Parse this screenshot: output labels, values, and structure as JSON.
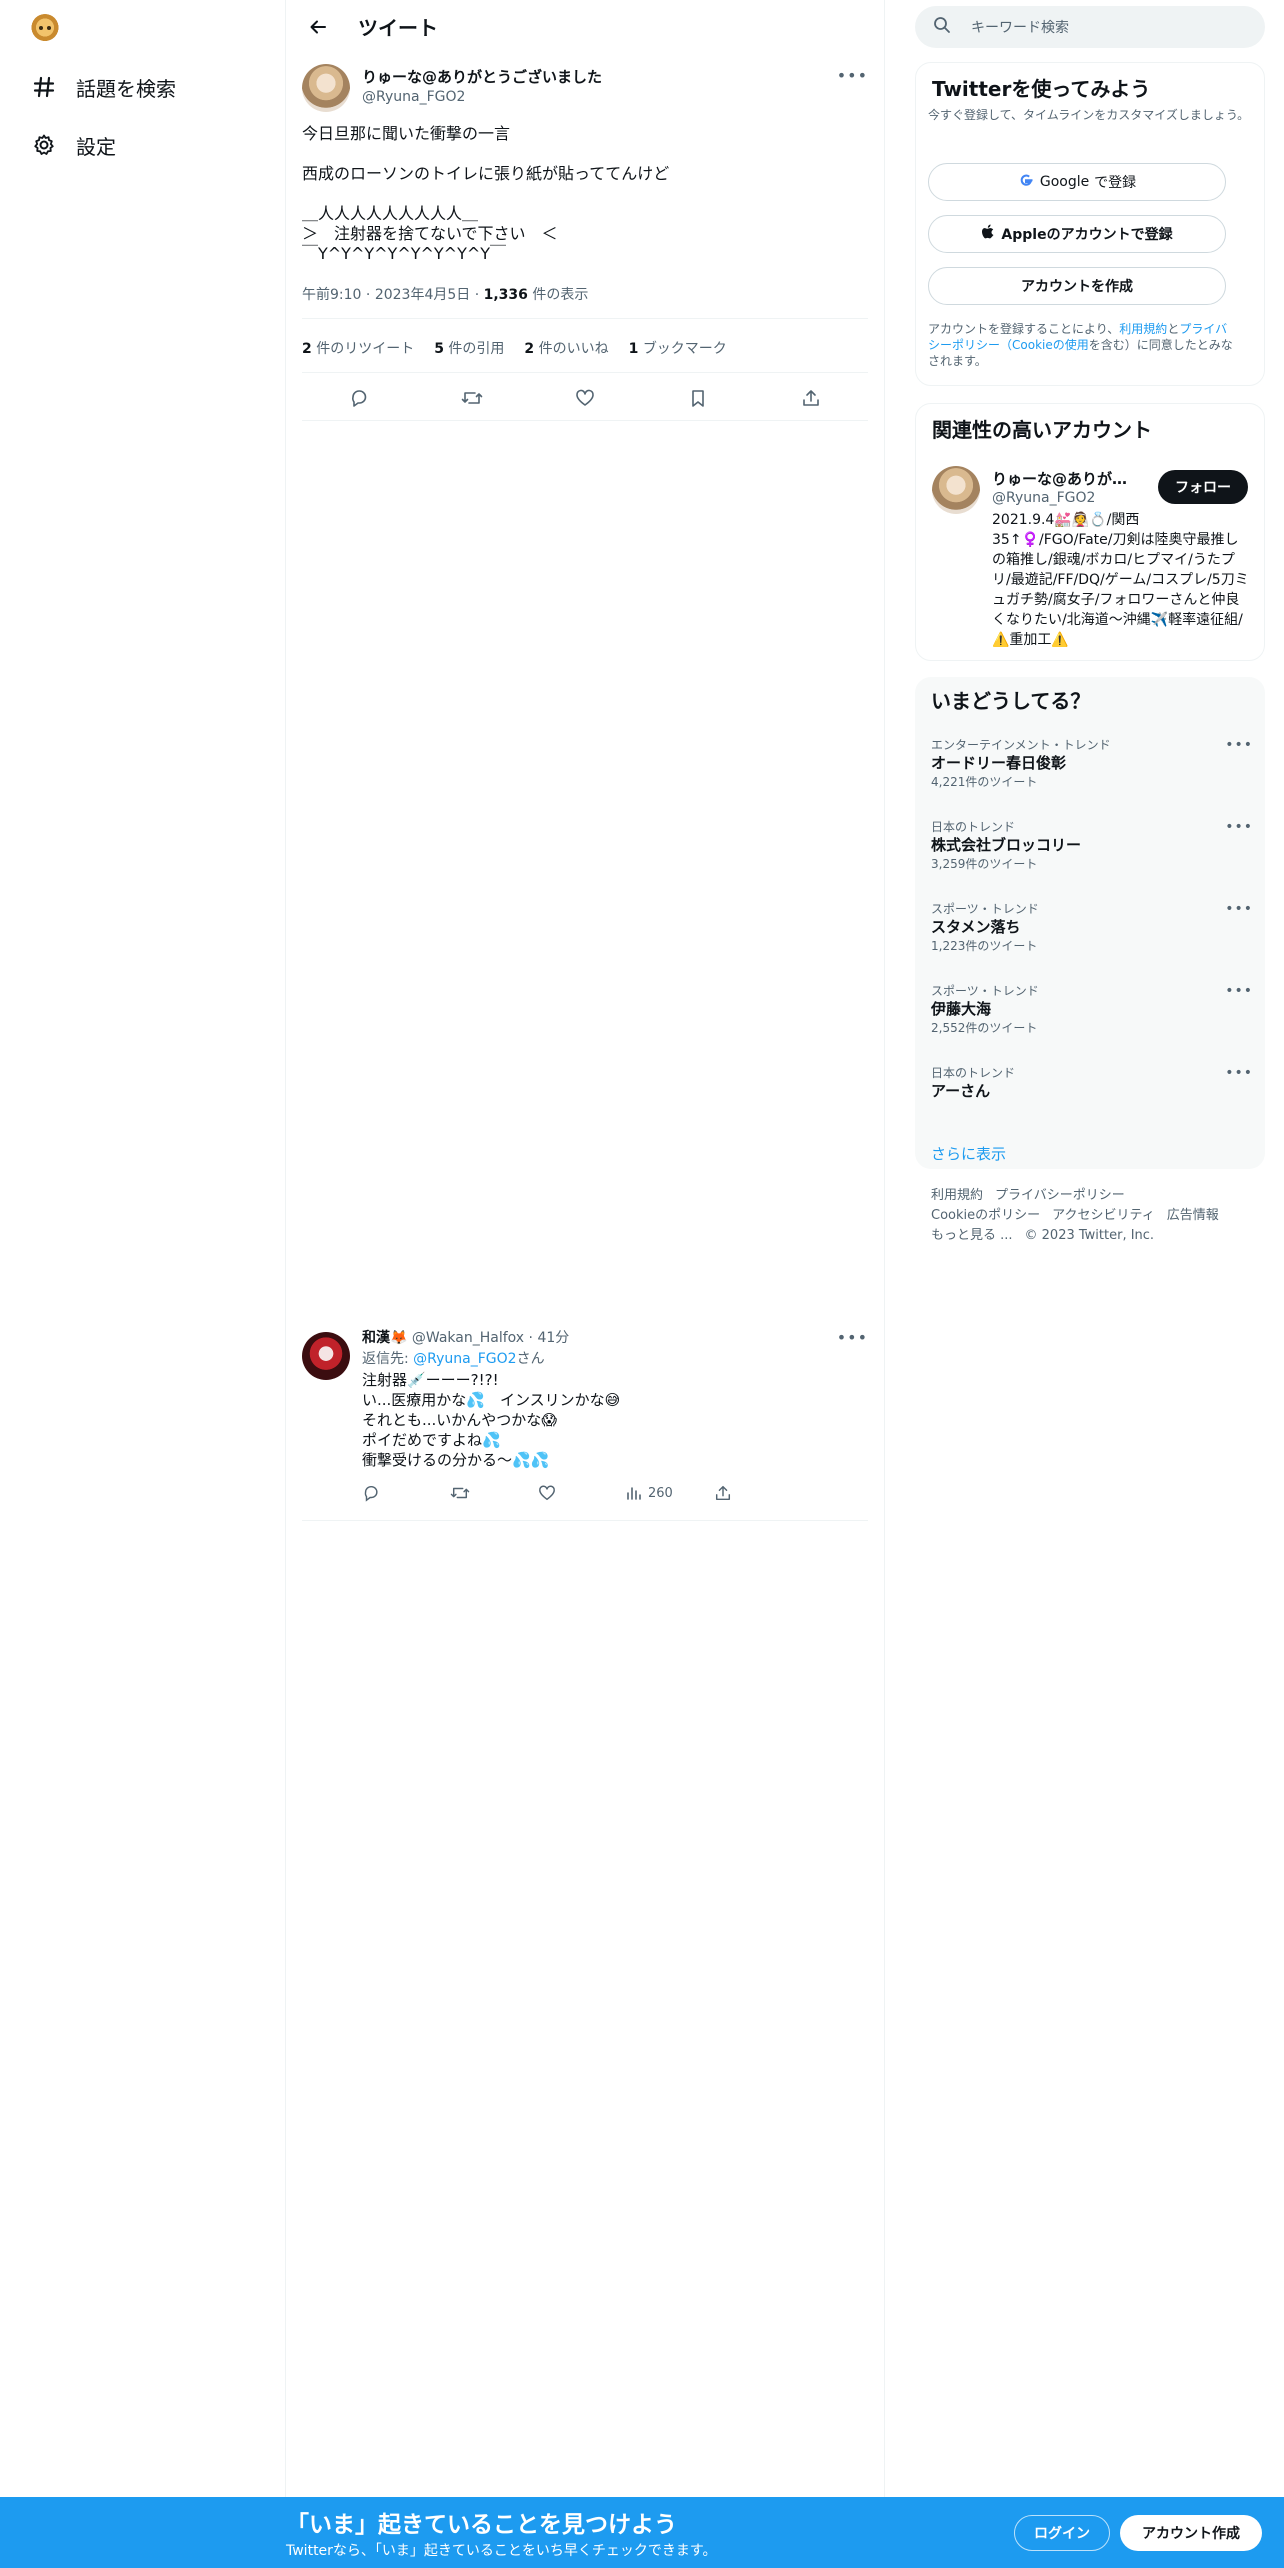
{
  "nav": {
    "items": [
      {
        "label": "話題を検索",
        "icon": "hashtag-icon"
      },
      {
        "label": "設定",
        "icon": "gear-icon"
      }
    ]
  },
  "header": {
    "title": "ツイート"
  },
  "tweet": {
    "name": "りゅーな@ありがとうございました",
    "handle": "@Ryuna_FGO2",
    "body": "今日旦那に聞いた衝撃の一言\n\n西成のローソンのトイレに張り紙が貼っててんけど\n\n＿人人人人人人人人人＿\n＞　注射器を捨てないで下さい　＜\n￣Y^Y^Y^Y^Y^Y^Y^Y￣",
    "time": "午前9:10",
    "date": "2023年4月5日",
    "views_count": "1,336",
    "views_label": "件の表示",
    "stats": [
      {
        "count": "2",
        "label": "件のリツイート"
      },
      {
        "count": "5",
        "label": "件の引用"
      },
      {
        "count": "2",
        "label": "件のいいね"
      },
      {
        "count": "1",
        "label": "ブックマーク"
      }
    ]
  },
  "reply": {
    "name": "和漢🦊",
    "handle": "@Wakan_Halfox",
    "time": "41分",
    "reply_prefix": "返信先: ",
    "reply_to": "@Ryuna_FGO2",
    "reply_suffix": "さん",
    "body": "注射器💉ーーー?!?!\nい...医療用かな💦　インスリンかな😅\nそれとも...いかんやつかな😱\nポイだめですよね💦\n衝撃受けるの分かる〜💦💦",
    "views": "260"
  },
  "search": {
    "placeholder": "キーワード検索"
  },
  "signup_box": {
    "title": "Twitterを使ってみよう",
    "subtitle": "今すぐ登録して、タイムラインをカスタマイズしましょう。",
    "google_g": "Google",
    "google_rest": "で登録",
    "apple": "Appleのアカウントで登録",
    "create": "アカウントを作成",
    "legal_1": "アカウントを登録することにより、",
    "legal_terms": "利用規約",
    "legal_2": "と",
    "legal_privacy": "プライバシーポリシー（Cookieの使用",
    "legal_3": "を含む）に同意したとみなされます。"
  },
  "related": {
    "title": "関連性の高いアカウント",
    "name": "りゅーな@ありがとうございました",
    "handle": "@Ryuna_FGO2",
    "follow": "フォロー",
    "bio": "2021.9.4💒👰💍/関西35↑♀️/FGO/Fate/刀剣は陸奥守最推しの箱推し/銀魂/ボカロ/ヒプマイ/うたプリ/最遊記/FF/DQ/ゲーム/コスプレ/5刀ミュガチ勢/腐女子/フォロワーさんと仲良くなりたい/北海道～沖縄✈️軽率遠征組/⚠️重加工⚠️"
  },
  "trends": {
    "title": "いまどうしてる？",
    "items": [
      {
        "context": "エンターテインメント・トレンド",
        "name": "オードリー春日俊彰",
        "count": "4,221件のツイート"
      },
      {
        "context": "日本のトレンド",
        "name": "株式会社ブロッコリー",
        "count": "3,259件のツイート"
      },
      {
        "context": "スポーツ・トレンド",
        "name": "スタメン落ち",
        "count": "1,223件のツイート"
      },
      {
        "context": "スポーツ・トレンド",
        "name": "伊藤大海",
        "count": "2,552件のツイート"
      },
      {
        "context": "日本のトレンド",
        "name": "アーさん",
        "count": ""
      }
    ],
    "show_more": "さらに表示"
  },
  "footer": {
    "terms": "利用規約",
    "privacy": "プライバシーポリシー",
    "cookie": "Cookieのポリシー",
    "accessibility": "アクセシビリティ",
    "ads": "広告情報",
    "more": "もっと見る ...",
    "copyright": "© 2023 Twitter, Inc."
  },
  "banner": {
    "title": "「いま」起きていることを見つけよう",
    "subtitle": "Twitterなら、「いま」起きていることをいち早くチェックできます。",
    "login": "ログイン",
    "signup": "アカウント作成"
  },
  "colors": {
    "accent": "#1d9bf0",
    "text": "#0f1419",
    "muted": "#536471"
  }
}
